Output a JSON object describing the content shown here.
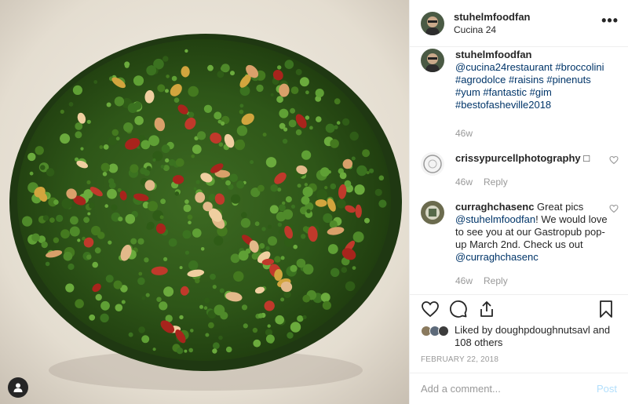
{
  "header": {
    "username": "stuhelmfoodfan",
    "location": "Cucina 24",
    "more": "•••"
  },
  "caption": {
    "username": "stuhelmfoodfan",
    "mention": "@cucina24restaurant",
    "tags": "#broccolini #agrodolce #raisins #pinenuts #yum #fantastic #gim #bestofasheville2018",
    "time": "46w"
  },
  "comments": [
    {
      "username": "crissypurcellphotography",
      "suffix": " □",
      "time": "46w",
      "reply": "Reply"
    },
    {
      "username": "curraghchasenc",
      "text1": " Great pics ",
      "mention1": "@stuhelmfoodfan",
      "text2": "! We would love to see you at our Gastropub pop-up March 2nd. Check us out ",
      "mention2": "@curraghchasenc",
      "time": "46w",
      "reply": "Reply"
    }
  ],
  "likes": {
    "prefix": "Liked by ",
    "user": "doughpdoughnutsavl",
    "suffix": " and",
    "others": "108 others"
  },
  "date": "FEBRUARY 22, 2018",
  "add_comment": {
    "placeholder": "Add a comment...",
    "post": "Post"
  },
  "icons": {
    "user_tag": "user-tag-icon",
    "heart": "heart-icon",
    "comment": "comment-icon",
    "share": "share-icon",
    "save": "bookmark-icon"
  }
}
